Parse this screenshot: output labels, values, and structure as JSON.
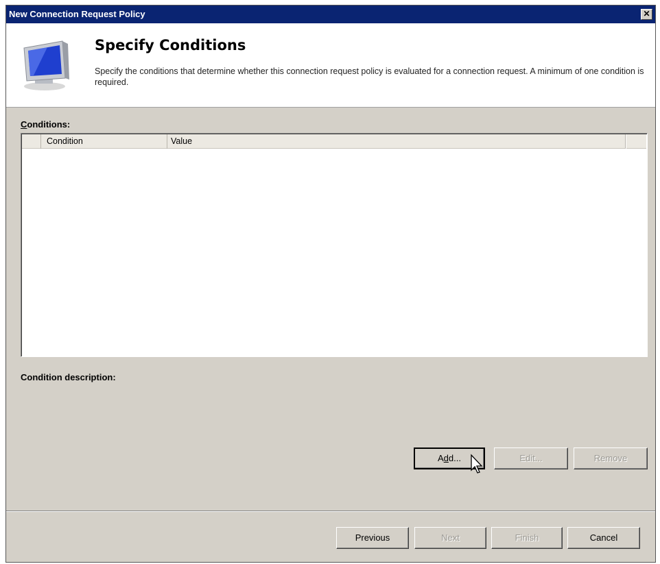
{
  "window": {
    "title": "New Connection Request Policy",
    "close_glyph": "✕"
  },
  "header": {
    "title": "Specify Conditions",
    "description": "Specify the conditions that determine whether this connection request policy is evaluated for a connection request. A minimum of one condition is required.",
    "icon": "computer-monitor-icon"
  },
  "conditions": {
    "label_accel": "C",
    "label_rest": "onditions:",
    "columns": [
      "Condition",
      "Value"
    ],
    "rows": []
  },
  "condition_description_label": "Condition description:",
  "condition_buttons": {
    "add": {
      "label": "Add...",
      "accel_index": 1
    },
    "edit": {
      "label": "Edit...",
      "disabled": true
    },
    "remove": {
      "label": "Remove",
      "disabled": true
    }
  },
  "footer_buttons": {
    "previous": "Previous",
    "next": "Next",
    "finish": "Finish",
    "cancel": "Cancel"
  },
  "colors": {
    "titlebar": "#0a2472",
    "dialog_bg": "#d4d0c8",
    "header_bg": "#ffffff"
  }
}
